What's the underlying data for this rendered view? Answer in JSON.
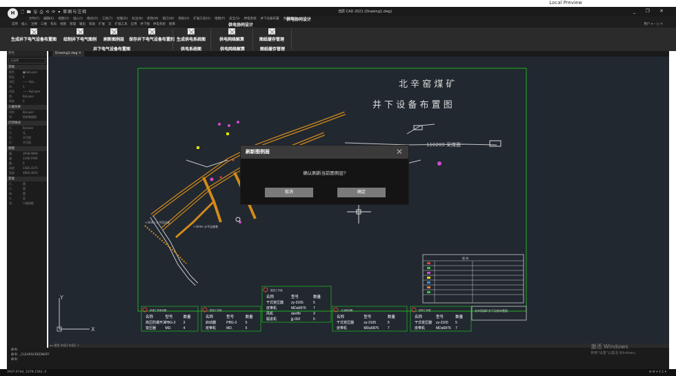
{
  "preview": {
    "label": "Local Preview"
  },
  "app": {
    "logo": "H",
    "quick_access": "🗋 🖿 🖫 ⎙ ⟲ ⟳ ▾ 草图与注释",
    "title": "浩辰 CAD 2021 (Drawing1.dwg)",
    "window_controls": "_ ❐ ✕"
  },
  "menu": {
    "items": [
      "文件(F)",
      "编辑(E)",
      "视图(V)",
      "插入(I)",
      "格式(O)",
      "工具(T)",
      "绘图(D)",
      "标注(N)",
      "修改(M)",
      "窗口(W)",
      "帮助(H)",
      "扩展工具(X)",
      "地图(P)",
      "安全(S)",
      "供电系统",
      "井下设备布置",
      "图层管理"
    ],
    "context_label": "供电协同设计"
  },
  "tabs": {
    "items": [
      "常用",
      "插入",
      "注释",
      "三维",
      "布局",
      "视图",
      "管理",
      "输出",
      "帮助",
      "扩展",
      "云",
      "扩展工具",
      "应用",
      "井下图",
      "供电系统",
      "图库"
    ],
    "active": "供电协同设计",
    "right": "用户 ▾ ─ □ ✕"
  },
  "ribbon": {
    "buttons": [
      {
        "label": "生成井下电气设备布置图"
      },
      {
        "label": "绘制井下电气图例"
      },
      {
        "label": "刷新图例层"
      },
      {
        "label": "保存井下电气设备布置图"
      },
      {
        "label": "生成供电系统图"
      },
      {
        "label": "供电网络解算"
      },
      {
        "label": "图纸缓存管理"
      }
    ],
    "groups": [
      "井下电气设备布置图",
      "供电系统图",
      "供电网络解算",
      "图纸缓存管理"
    ]
  },
  "left_panel": {
    "header": "特性",
    "combo": "无选择",
    "sections": [
      {
        "title": "常规",
        "rows": [
          [
            "颜色",
            "■ ByLayer"
          ],
          [
            "图层",
            "0"
          ],
          [
            "线型",
            "—— ByL.."
          ],
          [
            "线..",
            "1"
          ],
          [
            "线宽",
            "—— ByLayer"
          ],
          [
            "透..",
            "ByLayer"
          ],
          [
            "厚度",
            "0"
          ]
        ]
      },
      {
        "title": "三维效果",
        "rows": [
          [
            "材质",
            "ByLayer"
          ],
          [
            "阴..",
            "投射和接收"
          ]
        ]
      },
      {
        "title": "打印样式",
        "rows": [
          [
            "打..",
            "ByColor"
          ],
          [
            "打..",
            "无"
          ],
          [
            "打..",
            "不可用"
          ],
          [
            "打..",
            "不可用"
          ]
        ]
      },
      {
        "title": "视图",
        "rows": [
          [
            "圆..",
            "3938.9808"
          ],
          [
            "圆..",
            "1196.9784"
          ],
          [
            "圆..",
            "0"
          ],
          [
            "高度",
            "1585.3175"
          ],
          [
            "宽度",
            "4800.4020"
          ]
        ]
      },
      {
        "title": "其他",
        "rows": [
          [
            "打..",
            "是"
          ],
          [
            "打..",
            "是"
          ],
          [
            "每..",
            "是"
          ],
          [
            "U..",
            "否"
          ],
          [
            "视..",
            "二维线框"
          ]
        ]
      }
    ]
  },
  "document": {
    "tab": "Drawing1.dwg ✕"
  },
  "drawing": {
    "title_line1": "北 辛 窑 煤 矿",
    "title_line2": "井 下 设 备 布 置 图",
    "panel_label": "110203 采煤面",
    "road_label": "+304m 水平运输巷",
    "road_label2": "+304m 水平回风巷",
    "ucs_x": "X",
    "ucs_y": "Y",
    "tables": [
      {
        "title": "采煤工作面设备",
        "headers": [
          "名称",
          "型号",
          "数量"
        ],
        "rows": [
          [
            "高压防爆开关",
            "PBG-3",
            "3"
          ],
          [
            "变压器",
            "MD.",
            "4"
          ]
        ]
      },
      {
        "title": "掘进工作面",
        "headers": [
          "名称",
          "型号",
          "数量"
        ],
        "rows": [
          [
            "启动器",
            "PBG-3",
            "5"
          ],
          [
            "皮带机",
            "MD.",
            "5"
          ]
        ]
      },
      {
        "title": "掘进工作面",
        "headers": [
          "名称",
          "型号",
          "数量"
        ],
        "rows": [
          [
            "干式变压器",
            "zy-3165",
            "5"
          ],
          [
            "皮带机",
            "MDa5876",
            "7"
          ],
          [
            "风机",
            "denfhl",
            "3"
          ],
          [
            "掘进机",
            "jjj-002",
            "5"
          ]
        ]
      },
      {
        "title": "主运输设备",
        "headers": [
          "名称",
          "型号",
          "数量"
        ],
        "rows": [
          [
            "干式变压器",
            "zy-3165",
            "5"
          ],
          [
            "皮带机",
            "MDa5876",
            "7"
          ]
        ]
      },
      {
        "title": "回采工作面",
        "headers": [
          "名称",
          "型号",
          "数量"
        ],
        "rows": [
          [
            "干式变压器",
            "zy-3165",
            "5"
          ],
          [
            "皮带机",
            "MDa5876",
            "7"
          ]
        ]
      }
    ],
    "legend_title": "图  例",
    "titleblock": "北辛窑煤矿井下设备布置图"
  },
  "layout_tabs": "◂ ▸ 模型 布局1 布局2 +",
  "command": {
    "lines": [
      "命令:",
      "命令: _CLEARSCREENOFF",
      "命令:"
    ]
  },
  "status": {
    "coords": "3937.6744, 1078.1562, 0",
    "right": "⊕ ⚙ ▾ 1:1 ▾"
  },
  "watermark": {
    "line1": "激活 Windows",
    "line2": "转到\"设置\"以激活 Windows。"
  },
  "modal": {
    "title": "刷新图例层",
    "message": "确认刷新当前图例层?",
    "cancel": "取消",
    "ok": "确定",
    "close": "✕"
  },
  "colors": {
    "canvas": "#212830",
    "frame": "#22b022",
    "tunnel": "#d28a1a",
    "modal": "#141414"
  }
}
